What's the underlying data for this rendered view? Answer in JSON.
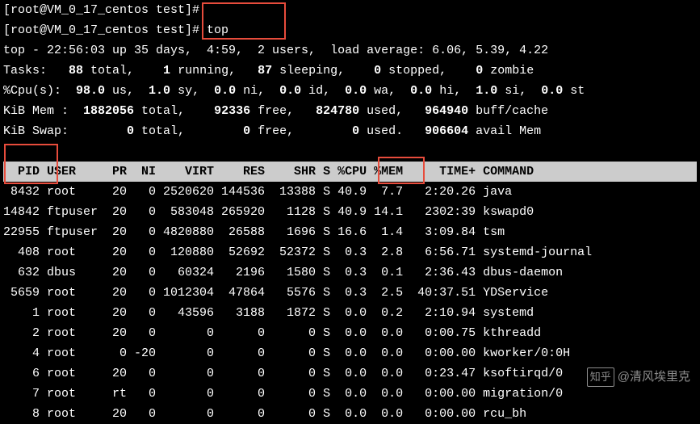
{
  "prompt1": "[root@VM_0_17_centos test]#",
  "prompt2": "[root@VM_0_17_centos test]# top",
  "summary": {
    "line1": "top - 22:56:03 up 35 days,  4:59,  2 users,  load average: 6.06, 5.39, 4.22",
    "tasks": {
      "label": "Tasks:",
      "total": "88",
      "total_lbl": "total,",
      "running": "1",
      "running_lbl": "running,",
      "sleeping": "87",
      "sleeping_lbl": "sleeping,",
      "stopped": "0",
      "stopped_lbl": "stopped,",
      "zombie": "0",
      "zombie_lbl": "zombie"
    },
    "cpu": {
      "label": "%Cpu(s):",
      "us": "98.0",
      "us_lbl": "us,",
      "sy": "1.0",
      "sy_lbl": "sy,",
      "ni": "0.0",
      "ni_lbl": "ni,",
      "id": "0.0",
      "id_lbl": "id,",
      "wa": "0.0",
      "wa_lbl": "wa,",
      "hi": "0.0",
      "hi_lbl": "hi,",
      "si": "1.0",
      "si_lbl": "si,",
      "st": "0.0",
      "st_lbl": "st"
    },
    "mem": {
      "label": "KiB Mem :",
      "total": "1882056",
      "total_lbl": "total,",
      "free": "92336",
      "free_lbl": "free,",
      "used": "824780",
      "used_lbl": "used,",
      "buff": "964940",
      "buff_lbl": "buff/cache"
    },
    "swap": {
      "label": "KiB Swap:",
      "total": "0",
      "total_lbl": "total,",
      "free": "0",
      "free_lbl": "free,",
      "used": "0",
      "used_lbl": "used.",
      "avail": "906604",
      "avail_lbl": "avail Mem"
    }
  },
  "headers": {
    "pid": "PID",
    "user": "USER",
    "pr": "PR",
    "ni": "NI",
    "virt": "VIRT",
    "res": "RES",
    "shr": "SHR",
    "s": "S",
    "cpu": "%CPU",
    "mem": "%MEM",
    "time": "TIME+",
    "cmd": "COMMAND"
  },
  "processes": [
    {
      "pid": "8432",
      "user": "root",
      "pr": "20",
      "ni": "0",
      "virt": "2520620",
      "res": "144536",
      "shr": "13388",
      "s": "S",
      "cpu": "40.9",
      "mem": "7.7",
      "time": "2:20.26",
      "cmd": "java"
    },
    {
      "pid": "14842",
      "user": "ftpuser",
      "pr": "20",
      "ni": "0",
      "virt": "583048",
      "res": "265920",
      "shr": "1128",
      "s": "S",
      "cpu": "40.9",
      "mem": "14.1",
      "time": "2302:39",
      "cmd": "kswapd0"
    },
    {
      "pid": "22955",
      "user": "ftpuser",
      "pr": "20",
      "ni": "0",
      "virt": "4820880",
      "res": "26588",
      "shr": "1696",
      "s": "S",
      "cpu": "16.6",
      "mem": "1.4",
      "time": "3:09.84",
      "cmd": "tsm"
    },
    {
      "pid": "408",
      "user": "root",
      "pr": "20",
      "ni": "0",
      "virt": "120880",
      "res": "52692",
      "shr": "52372",
      "s": "S",
      "cpu": "0.3",
      "mem": "2.8",
      "time": "6:56.71",
      "cmd": "systemd-journal"
    },
    {
      "pid": "632",
      "user": "dbus",
      "pr": "20",
      "ni": "0",
      "virt": "60324",
      "res": "2196",
      "shr": "1580",
      "s": "S",
      "cpu": "0.3",
      "mem": "0.1",
      "time": "2:36.43",
      "cmd": "dbus-daemon"
    },
    {
      "pid": "5659",
      "user": "root",
      "pr": "20",
      "ni": "0",
      "virt": "1012304",
      "res": "47864",
      "shr": "5576",
      "s": "S",
      "cpu": "0.3",
      "mem": "2.5",
      "time": "40:37.51",
      "cmd": "YDService"
    },
    {
      "pid": "1",
      "user": "root",
      "pr": "20",
      "ni": "0",
      "virt": "43596",
      "res": "3188",
      "shr": "1872",
      "s": "S",
      "cpu": "0.0",
      "mem": "0.2",
      "time": "2:10.94",
      "cmd": "systemd"
    },
    {
      "pid": "2",
      "user": "root",
      "pr": "20",
      "ni": "0",
      "virt": "0",
      "res": "0",
      "shr": "0",
      "s": "S",
      "cpu": "0.0",
      "mem": "0.0",
      "time": "0:00.75",
      "cmd": "kthreadd"
    },
    {
      "pid": "4",
      "user": "root",
      "pr": "0",
      "ni": "-20",
      "virt": "0",
      "res": "0",
      "shr": "0",
      "s": "S",
      "cpu": "0.0",
      "mem": "0.0",
      "time": "0:00.00",
      "cmd": "kworker/0:0H"
    },
    {
      "pid": "6",
      "user": "root",
      "pr": "20",
      "ni": "0",
      "virt": "0",
      "res": "0",
      "shr": "0",
      "s": "S",
      "cpu": "0.0",
      "mem": "0.0",
      "time": "0:23.47",
      "cmd": "ksoftirqd/0"
    },
    {
      "pid": "7",
      "user": "root",
      "pr": "rt",
      "ni": "0",
      "virt": "0",
      "res": "0",
      "shr": "0",
      "s": "S",
      "cpu": "0.0",
      "mem": "0.0",
      "time": "0:00.00",
      "cmd": "migration/0"
    },
    {
      "pid": "8",
      "user": "root",
      "pr": "20",
      "ni": "0",
      "virt": "0",
      "res": "0",
      "shr": "0",
      "s": "S",
      "cpu": "0.0",
      "mem": "0.0",
      "time": "0:00.00",
      "cmd": "rcu_bh"
    }
  ],
  "watermark": {
    "brand": "知乎",
    "author": "@清风埃里克"
  }
}
